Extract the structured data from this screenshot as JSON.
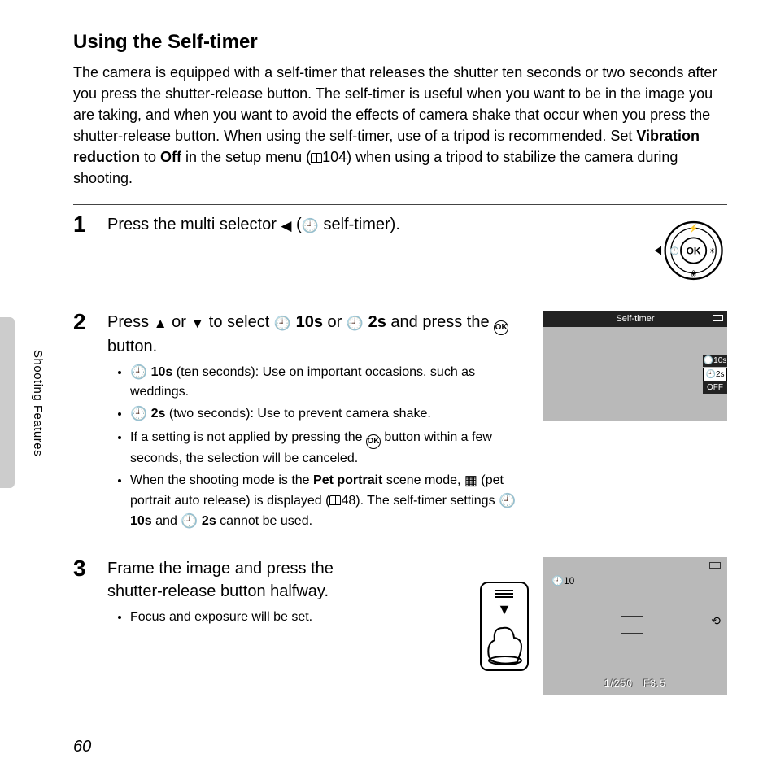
{
  "title": "Using the Self-timer",
  "intro_parts": {
    "p1": "The camera is equipped with a self-timer that releases the shutter ten seconds or two seconds after you press the shutter-release button. The self-timer is useful when you want to be in the image you are taking, and when you want to avoid the effects of camera shake that occur when you press the shutter-release button. When using the self-timer, use of a tripod is recommended. Set ",
    "vr": "Vibration reduction",
    "p2": " to ",
    "off": "Off",
    "p3": " in the setup menu (",
    "ref1": "104",
    "p4": ") when using a tripod to stabilize the camera during shooting."
  },
  "steps": {
    "s1": {
      "num": "1",
      "title_a": "Press the multi selector ",
      "title_b": " (",
      "title_c": " self-timer)."
    },
    "s2": {
      "num": "2",
      "title_a": "Press ",
      "title_b": " or ",
      "title_c": " to select ",
      "t10s": "10s",
      "title_d": " or ",
      "t2s": "2s",
      "title_e": " and press the ",
      "title_f": " button.",
      "b1_a": "10s",
      "b1_b": " (ten seconds): Use on important occasions, such as weddings.",
      "b2_a": "2s",
      "b2_b": " (two seconds): Use to prevent camera shake.",
      "b3": "If a setting is not applied by pressing the ",
      "b3b": " button within a few seconds, the selection will be canceled.",
      "b4a": "When the shooting mode is the ",
      "b4pet": "Pet portrait",
      "b4b": " scene mode, ",
      "b4c": " (pet portrait auto release) is displayed (",
      "b4ref": "48",
      "b4d": "). The self-timer settings ",
      "b4_10s": "10s",
      "b4e": " and ",
      "b4_2s": "2s",
      "b4f": " cannot be used."
    },
    "s3": {
      "num": "3",
      "title": "Frame the image and press the shutter-release button halfway.",
      "b1": "Focus and exposure will be set."
    }
  },
  "screen1": {
    "title": "Self-timer",
    "opt1": "10s",
    "opt2": "2s",
    "opt3": "OFF"
  },
  "screen2": {
    "timer": "10",
    "shutter": "1/250",
    "aperture": "F3.5"
  },
  "dial_ok": "OK",
  "side_label": "Shooting Features",
  "page_number": "60"
}
